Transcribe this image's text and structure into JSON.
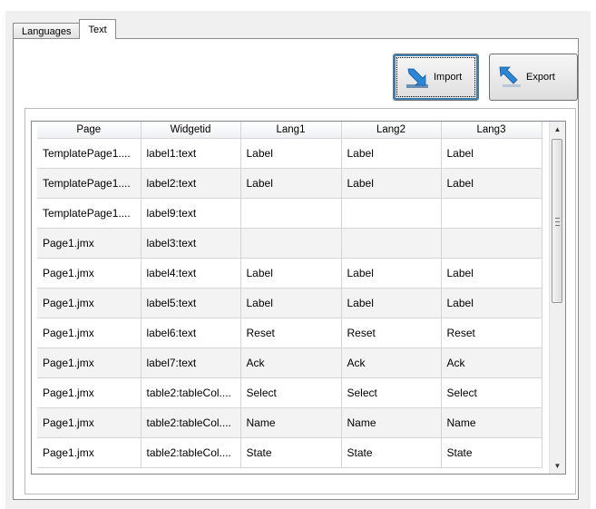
{
  "tabs": [
    {
      "label": "Languages",
      "active": false
    },
    {
      "label": "Text",
      "active": true
    }
  ],
  "toolbar": {
    "import_label": "Import",
    "export_label": "Export",
    "import_icon": "arrow-down-right-icon",
    "export_icon": "arrow-up-left-icon",
    "icon_color": "#2a86d6"
  },
  "table": {
    "columns": [
      "Page",
      "Widgetid",
      "Lang1",
      "Lang2",
      "Lang3"
    ],
    "rows": [
      [
        "TemplatePage1....",
        "label1:text",
        "Label",
        "Label",
        "Label"
      ],
      [
        "TemplatePage1....",
        "label2:text",
        "Label",
        "Label",
        "Label"
      ],
      [
        "TemplatePage1....",
        "label9:text",
        "",
        "",
        ""
      ],
      [
        "Page1.jmx",
        "label3:text",
        "",
        "",
        ""
      ],
      [
        "Page1.jmx",
        "label4:text",
        "Label",
        "Label",
        "Label"
      ],
      [
        "Page1.jmx",
        "label5:text",
        "Label",
        "Label",
        "Label"
      ],
      [
        "Page1.jmx",
        "label6:text",
        "Reset",
        "Reset",
        "Reset"
      ],
      [
        "Page1.jmx",
        "label7:text",
        "Ack",
        "Ack",
        "Ack"
      ],
      [
        "Page1.jmx",
        "table2:tableCol....",
        "Select",
        "Select",
        "Select"
      ],
      [
        "Page1.jmx",
        "table2:tableCol....",
        "Name",
        "Name",
        "Name"
      ],
      [
        "Page1.jmx",
        "table2:tableCol....",
        "State",
        "State",
        "State"
      ]
    ]
  },
  "scrollbar": {
    "up_glyph": "▲",
    "down_glyph": "▼"
  }
}
